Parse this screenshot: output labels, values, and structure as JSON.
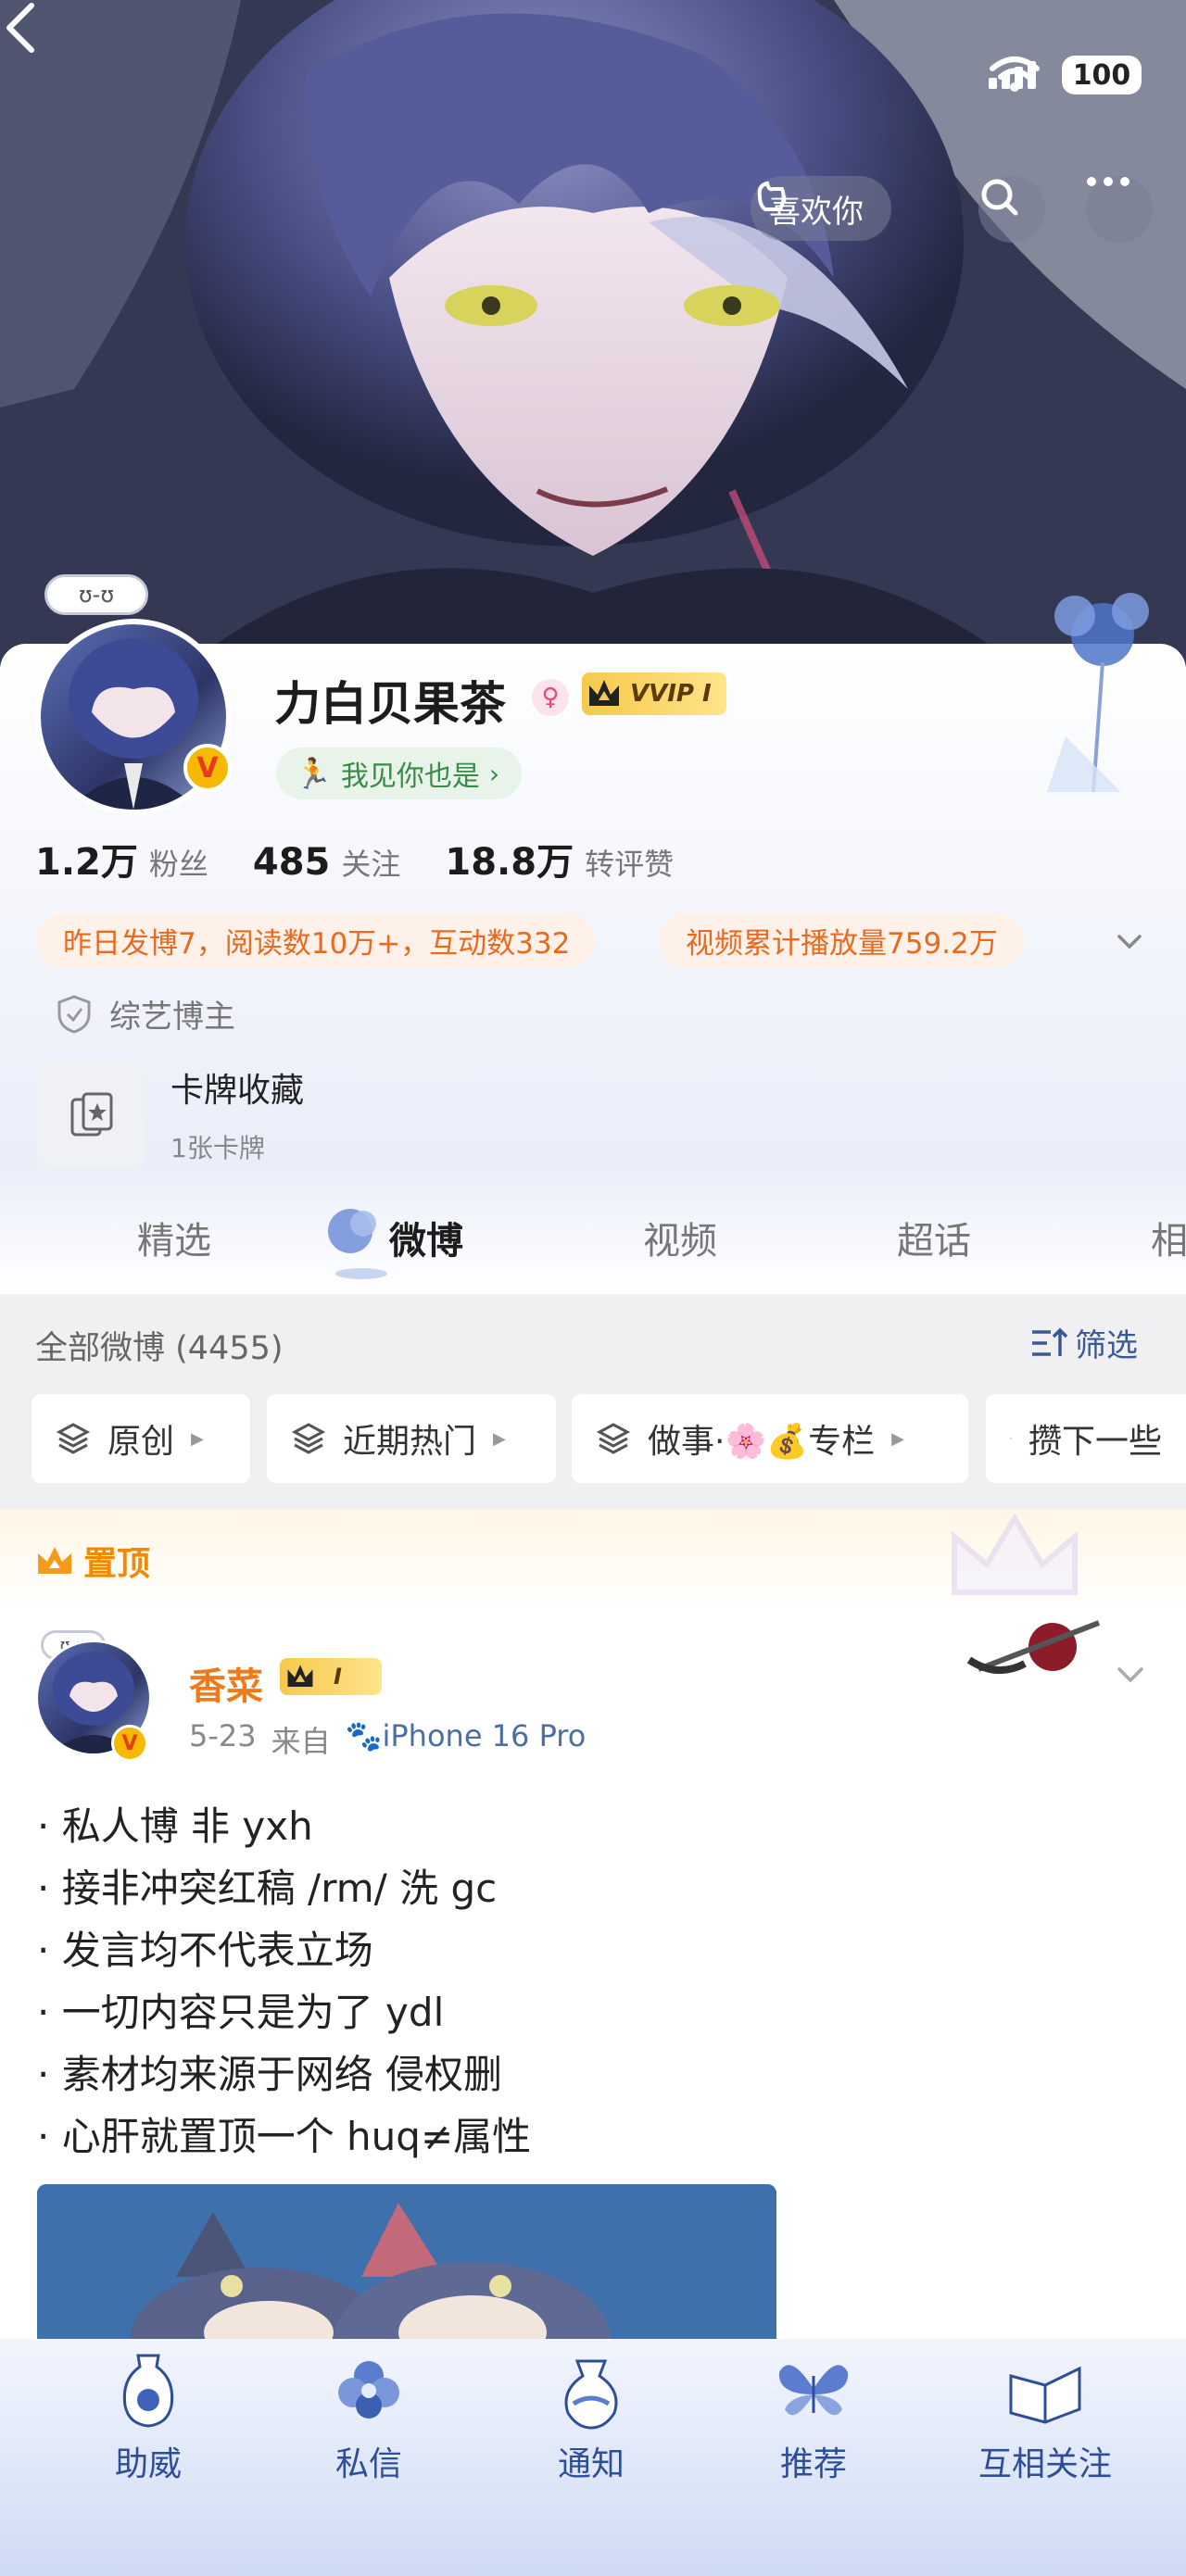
{
  "status": {
    "battery": "100"
  },
  "header": {
    "like_label": "喜欢你"
  },
  "profile": {
    "avatar_badge": "ʊ-ʊ",
    "name": "力白贝果茶",
    "vip_label": "VVIP I",
    "tag": "我见你也是",
    "stats": [
      {
        "num": "1.2万",
        "label": "粉丝"
      },
      {
        "num": "485",
        "label": "关注"
      },
      {
        "num": "18.8万",
        "label": "转评赞"
      }
    ],
    "highlights": [
      "昨日发博7，阅读数10万+，互动数332",
      "视频累计播放量759.2万"
    ],
    "role": "综艺博主",
    "cards": {
      "title": "卡牌收藏",
      "sub": "1张卡牌"
    }
  },
  "tabs": [
    "精选",
    "微博",
    "视频",
    "超话",
    "相"
  ],
  "filter": {
    "all": "全部微博 (4455)",
    "screen": "筛选",
    "chips": [
      "原创",
      "近期热门",
      "做事·🌸💰专栏",
      "攒下一些"
    ]
  },
  "pinned": {
    "label": "置顶",
    "post": {
      "avatar_badge": "ʊ-ʊ",
      "name": "香菜",
      "vip_level": "I",
      "date": "5-23",
      "from": "来自",
      "device": "iPhone 16 Pro",
      "lines": [
        "· 私人博 非 yxh",
        "· 接非冲突红稿 /rm/ 洗 gc",
        "· 发言均不代表立场",
        "· 一切内容只是为了 ydl",
        "· 素材均来源于网络 侵权删",
        "· 心肝就置顶一个 huq≠属性"
      ]
    }
  },
  "bottom": [
    "助威",
    "私信",
    "通知",
    "推荐",
    "互相关注"
  ],
  "colors": {
    "accent_orange": "#f07a1a",
    "link_blue": "#3a5796",
    "pinned": "#f08a00"
  }
}
